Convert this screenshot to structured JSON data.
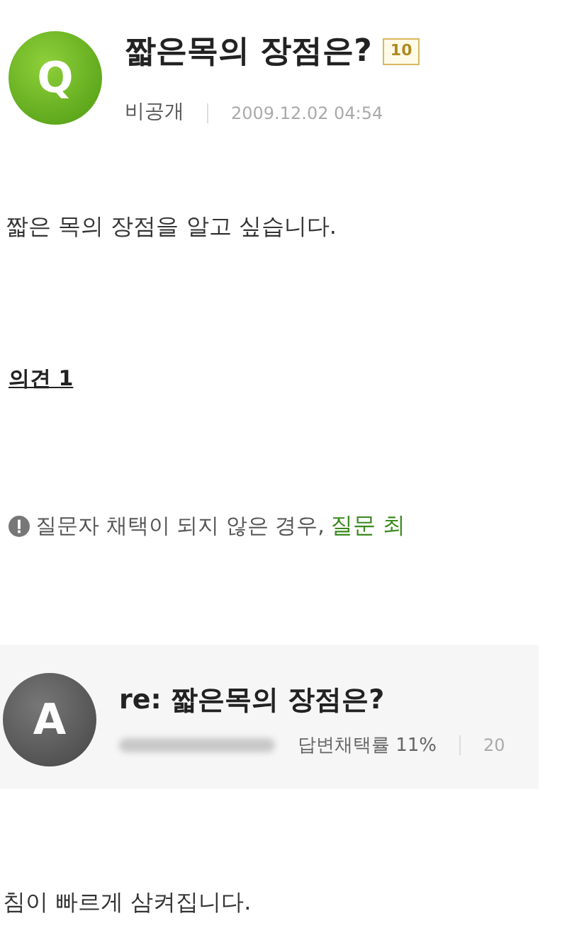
{
  "question": {
    "avatar_letter": "Q",
    "title": "짧은목의 장점은?",
    "points": "10",
    "author": "비공개",
    "date": "2009.12.02 04:54",
    "body": "짧은 목의 장점을 알고 싶습니다."
  },
  "opinion_heading": "의견 1",
  "notice": {
    "text": "질문자 채택이 되지 않은 경우,",
    "link": "질문 최"
  },
  "answer": {
    "avatar_letter": "A",
    "title": "re: 짧은목의 장점은?",
    "adoption_rate": "답변채택률 11%",
    "date": "20",
    "body": "침이 빠르게 삼켜집니다."
  }
}
